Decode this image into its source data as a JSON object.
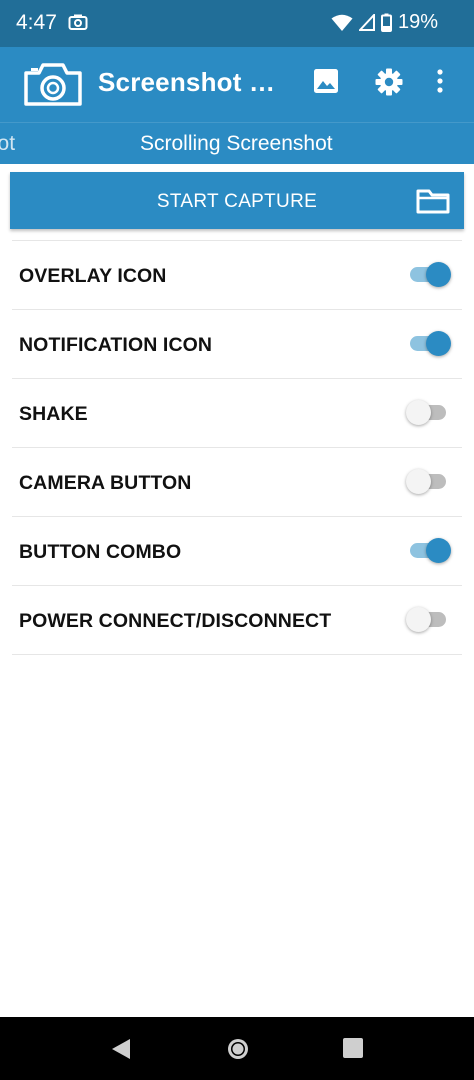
{
  "status": {
    "time": "4:47",
    "battery": "19%",
    "icons": [
      "camera-notification-icon",
      "wifi-icon",
      "cell-signal-icon",
      "battery-icon"
    ]
  },
  "app_bar": {
    "title": "Screenshot Ea...",
    "actions": [
      "gallery-icon",
      "settings-icon",
      "more-vert-icon"
    ]
  },
  "tabs": [
    {
      "label": "enshot",
      "selected": false
    },
    {
      "label": "Scrolling Screenshot",
      "selected": true
    }
  ],
  "capture": {
    "label": "START CAPTURE",
    "icon": "folder-icon"
  },
  "settings": [
    {
      "label": "OVERLAY ICON",
      "enabled": true
    },
    {
      "label": "NOTIFICATION ICON",
      "enabled": true
    },
    {
      "label": "SHAKE",
      "enabled": false
    },
    {
      "label": "CAMERA BUTTON",
      "enabled": false
    },
    {
      "label": "BUTTON COMBO",
      "enabled": true
    },
    {
      "label": "POWER CONNECT/DISCONNECT",
      "enabled": false
    }
  ],
  "colors": {
    "status_bar": "#216e98",
    "primary": "#2b8bc3",
    "switch_on_track": "#8ec3e0",
    "switch_off_track": "#bdbdbd"
  },
  "nav": [
    "back-icon",
    "home-icon",
    "recents-icon"
  ]
}
